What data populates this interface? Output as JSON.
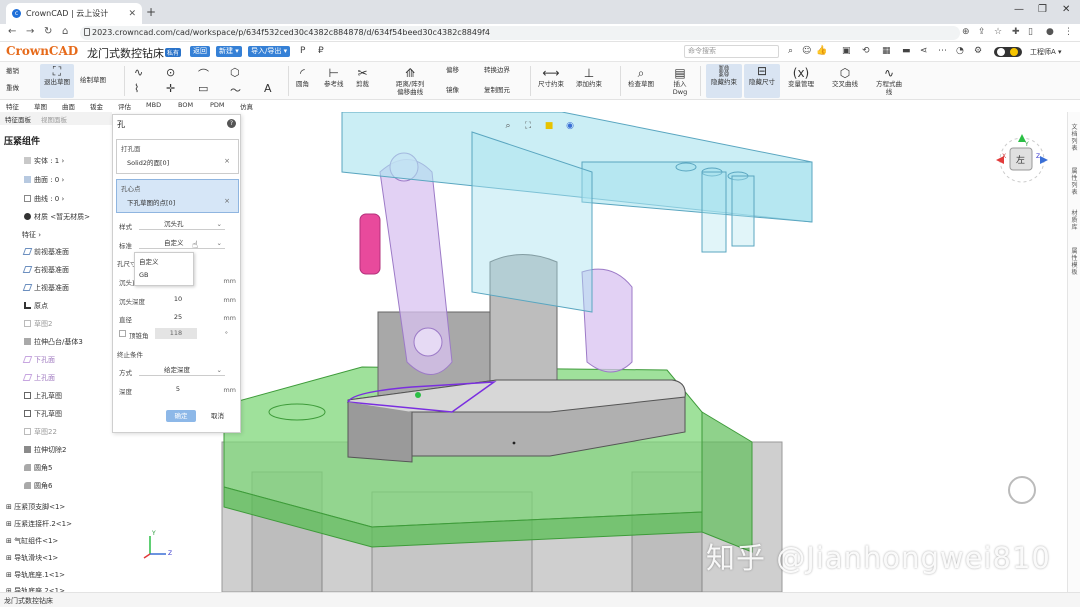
{
  "browser": {
    "tab_title": "CrownCAD | 云上设计",
    "url": "2023.crowncad.com/cad/workspace/p/634f532ced30c4382c884878/d/634f54beed30c4382c8849f4"
  },
  "app": {
    "logo_main": "CrownCAD",
    "project_title": "龙门式数控钻床",
    "private_badge": "私有",
    "btn_back": "返回",
    "btn_new": "新建 ▾",
    "btn_import_export": "导入/导出 ▾",
    "search_placeholder": "命令搜索",
    "user_name": "工程师A ▾"
  },
  "ribbon": {
    "undo": "撤销",
    "redo": "重做",
    "exit_sketch": "退出草图",
    "smart_dim_1": "退出草图",
    "draw_sketch": "绘制草图",
    "sketch_lines": "直线/折线",
    "sketch_circle": "圆",
    "sketch_arc": "圆弧",
    "sketch_rect": "矩形",
    "sketch_ellipse": "椭圆",
    "sketch_text": "文本",
    "fillet": "圆角",
    "ref_line": "参考线",
    "trim": "剪裁",
    "dist_offset": "距离/阵列",
    "offset_curve": "偏移曲线",
    "offset": "偏移",
    "convert_edge": "转换边界",
    "mirror": "镜像",
    "copy_entity": "复制图元",
    "dim_constraint": "尺寸约束",
    "add_constraint": "添加约束",
    "check_sketch": "检查草图",
    "insert_dwg": "插入 Dwg",
    "hide_constraint": "隐藏约束",
    "hide_dim": "隐藏尺寸",
    "variable_mgr": "变量管理",
    "intersect_curve": "交叉曲线",
    "equation_curve": "方程式曲线"
  },
  "feature_tabs": [
    "特征",
    "草图",
    "曲面",
    "钣金",
    "评估",
    "MBD",
    "BOM",
    "PDM",
    "仿真"
  ],
  "left_panel": {
    "tab_feature": "特征面板",
    "tab_view": "视图面板",
    "root": "压紧组件",
    "nodes": [
      {
        "label": "实体 : 1 ›",
        "style": "normal"
      },
      {
        "label": "曲面 : 0 ›",
        "style": "normal"
      },
      {
        "label": "曲线 : 0 ›",
        "style": "normal"
      },
      {
        "label": "材质 <暂无材质>",
        "style": "normal"
      },
      {
        "label": "特征 ›",
        "style": "normal"
      },
      {
        "label": "前视基准面",
        "style": "normal"
      },
      {
        "label": "右视基准面",
        "style": "normal"
      },
      {
        "label": "上视基准面",
        "style": "normal"
      },
      {
        "label": "原点",
        "style": "normal"
      },
      {
        "label": "草图2",
        "style": "muted"
      },
      {
        "label": "拉伸凸台/基体3",
        "style": "normal"
      },
      {
        "label": "下孔面",
        "style": "pink"
      },
      {
        "label": "上孔面",
        "style": "pink"
      },
      {
        "label": "上孔草图",
        "style": "normal"
      },
      {
        "label": "下孔草图",
        "style": "normal"
      },
      {
        "label": "草图22",
        "style": "muted"
      },
      {
        "label": "拉伸切除2",
        "style": "normal"
      },
      {
        "label": "圆角5",
        "style": "normal"
      },
      {
        "label": "圆角6",
        "style": "normal"
      }
    ],
    "assemblies": [
      "压紧顶支脚<1>",
      "压紧连接杆.2<1>",
      "气缸组件<1>",
      "导轨滑块<1>",
      "导轨底座.1<1>",
      "导轨底座.2<1>"
    ]
  },
  "hole_dialog": {
    "title": "孔",
    "face_label": "打孔面",
    "face_value": "Solid2的面[0]",
    "center_label": "孔心点",
    "center_value": "下孔草图的点[0]",
    "style_label": "样式",
    "style_value": "沉头孔",
    "standard_label": "标准",
    "standard_value": "自定义",
    "spec_label": "孔尺寸",
    "cbore_dia_label": "沉头直径",
    "cbore_depth_label": "沉头深度",
    "cbore_depth_value": "10",
    "dia_label": "直径",
    "dia_value": "25",
    "top_angle_label": "顶锥角",
    "top_angle_value": "118",
    "top_angle_unit": "°",
    "unit_mm": "mm",
    "end_label": "终止条件",
    "method_label": "方式",
    "method_value": "给定深度",
    "depth_label": "深度",
    "depth_value": "5",
    "ok": "确定",
    "cancel": "取消",
    "dropdown_options": [
      "自定义",
      "GB"
    ]
  },
  "viewcube": {
    "face": "左",
    "axis_x": "X",
    "axis_y": "Y",
    "axis_z": "Z"
  },
  "right_rail": [
    "文档列表",
    "属性列表",
    "材质库",
    "属性模板"
  ],
  "status_bar": "龙门式数控钻床",
  "watermark": "知乎 @Jianhongwei810",
  "triad": {
    "y": "Y",
    "z": "Z"
  },
  "colors": {
    "accent": "#3580d6",
    "green_part": "#7fd77a",
    "gray_part": "#9a9a9a",
    "blue_part": "#a9e2ef",
    "purple_part": "#d8c2f0",
    "pink_part": "#e84a9c",
    "highlight_edge": "#7a2ee0"
  }
}
